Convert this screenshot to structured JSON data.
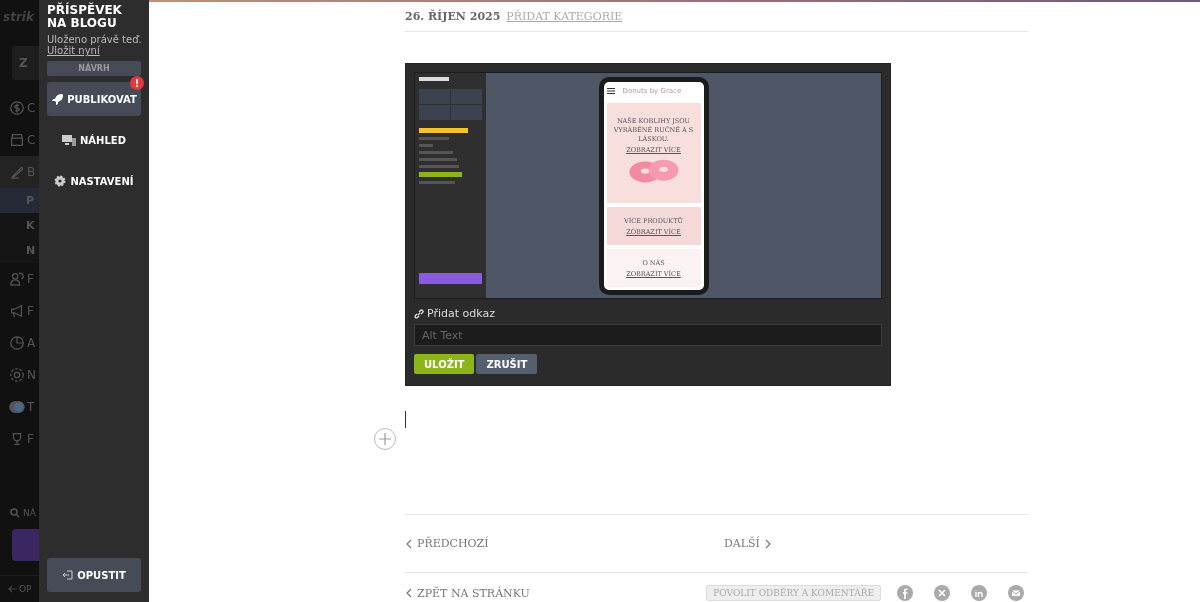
{
  "app_sidebar": {
    "logo": "strik",
    "back_label": "Z",
    "items": [
      {
        "kind": "dollar",
        "label": "C",
        "selected": false
      },
      {
        "kind": "store",
        "label": "C",
        "selected": false
      },
      {
        "kind": "pen",
        "label": "B",
        "selected": true,
        "children": [
          {
            "label": "P",
            "selected": true
          },
          {
            "label": "K",
            "selected": false
          },
          {
            "label": "N",
            "selected": false
          }
        ]
      },
      {
        "kind": "people",
        "label": "F",
        "selected": false
      },
      {
        "kind": "megaphone",
        "label": "F",
        "selected": false
      },
      {
        "kind": "pie",
        "label": "A",
        "selected": false
      },
      {
        "kind": "gear",
        "label": "N",
        "selected": false
      },
      {
        "kind": "avatar",
        "label": "T",
        "selected": false
      },
      {
        "kind": "trophy",
        "label": "F",
        "selected": false
      }
    ],
    "search_label": "NÁ",
    "exit_label": "OP"
  },
  "panel": {
    "title": "PŘÍSPĚVEK NA BLOGU",
    "saved_text": "Uloženo právě teď.",
    "save_link": "Uložit nyní",
    "status": "NÁVRH",
    "actions": [
      {
        "kind": "publish",
        "label": "PUBLIKOVAT",
        "alert": "!"
      },
      {
        "kind": "preview",
        "label": "NÁHLED"
      },
      {
        "kind": "settings",
        "label": "NASTAVENÍ"
      }
    ],
    "exit": "OPUSTIT"
  },
  "post": {
    "date": "26. ŘÍJEN 2025",
    "category_link": "PŘIDAT KATEGORIE",
    "image_editor": {
      "screenshot": {
        "phone": {
          "brand": "Donuts by Grace",
          "sections": [
            {
              "kind": "hero",
              "heading": "NAŠE KOBLIHY JSOU VYRÁBĚNÉ RUČNĚ A S LÁSKOU.",
              "link": "ZOBRAZIT VÍCE"
            },
            {
              "kind": "plain",
              "heading": "VÍCE PRODUKTŮ",
              "link": "ZOBRAZIT VÍCE"
            },
            {
              "kind": "light",
              "heading": "O NÁS",
              "link": "ZOBRAZIT VÍCE"
            }
          ]
        }
      },
      "add_link": "Přidat odkaz",
      "alt_placeholder": "Alt Text",
      "save": "ULOŽIT",
      "cancel": "ZRUŠIT"
    },
    "prev": "PŘEDCHOZÍ",
    "next": "DALŠÍ",
    "back": "ZPĚT NA STRÁNKU",
    "subscribe": "POVOLIT ODBĚRY A KOMENTÁŘE",
    "share": [
      {
        "kind": "facebook"
      },
      {
        "kind": "x"
      },
      {
        "kind": "linkedin"
      },
      {
        "kind": "email"
      }
    ]
  }
}
